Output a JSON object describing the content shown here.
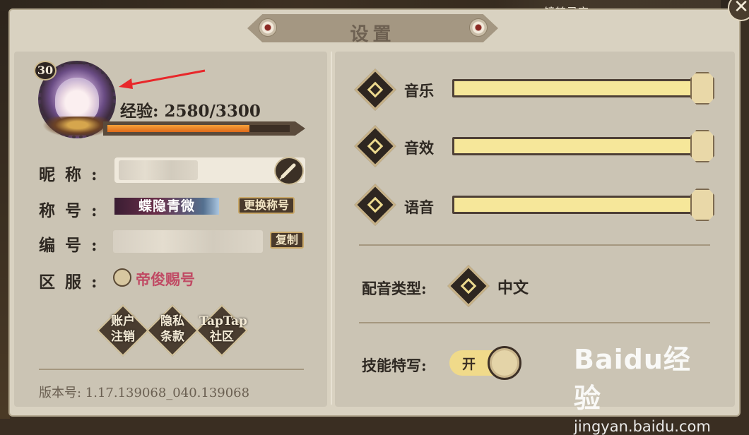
{
  "header": {
    "title": "设置",
    "top_right_label": "镜转灵室",
    "close_glyph": "✕"
  },
  "profile": {
    "level": "30",
    "exp_text": "经验: 2580/3300",
    "exp_progress": 0.78,
    "nickname_label": "昵称:",
    "title_label": "称号:",
    "title_value": "蝶隐青微",
    "change_title_button": "更换称号",
    "id_label": "编号:",
    "copy_button": "复制",
    "server_label": "区服:",
    "server_value": "帝俊赐号",
    "buttons": [
      {
        "line1": "账户",
        "line2": "注销"
      },
      {
        "line1": "隐私",
        "line2": "条款"
      },
      {
        "line1": "TapTap",
        "line2": "社区"
      }
    ],
    "version": "版本号: 1.17.139068_040.139068"
  },
  "settings": {
    "volumes": [
      {
        "label": "音乐",
        "value": 1.0
      },
      {
        "label": "音效",
        "value": 1.0
      },
      {
        "label": "语音",
        "value": 1.0
      }
    ],
    "voice_type_label": "配音类型:",
    "voice_type_value": "中文",
    "skill_closeup_label": "技能特写:",
    "skill_closeup_state": "开"
  },
  "watermark": {
    "logo": "Baidu经验",
    "url": "jingyan.baidu.com"
  },
  "colors": {
    "panel": "#d9d2c1",
    "slider_fill": "#f6e79a",
    "server_text": "#c04a64",
    "exp_fill": "#f5a23a"
  }
}
